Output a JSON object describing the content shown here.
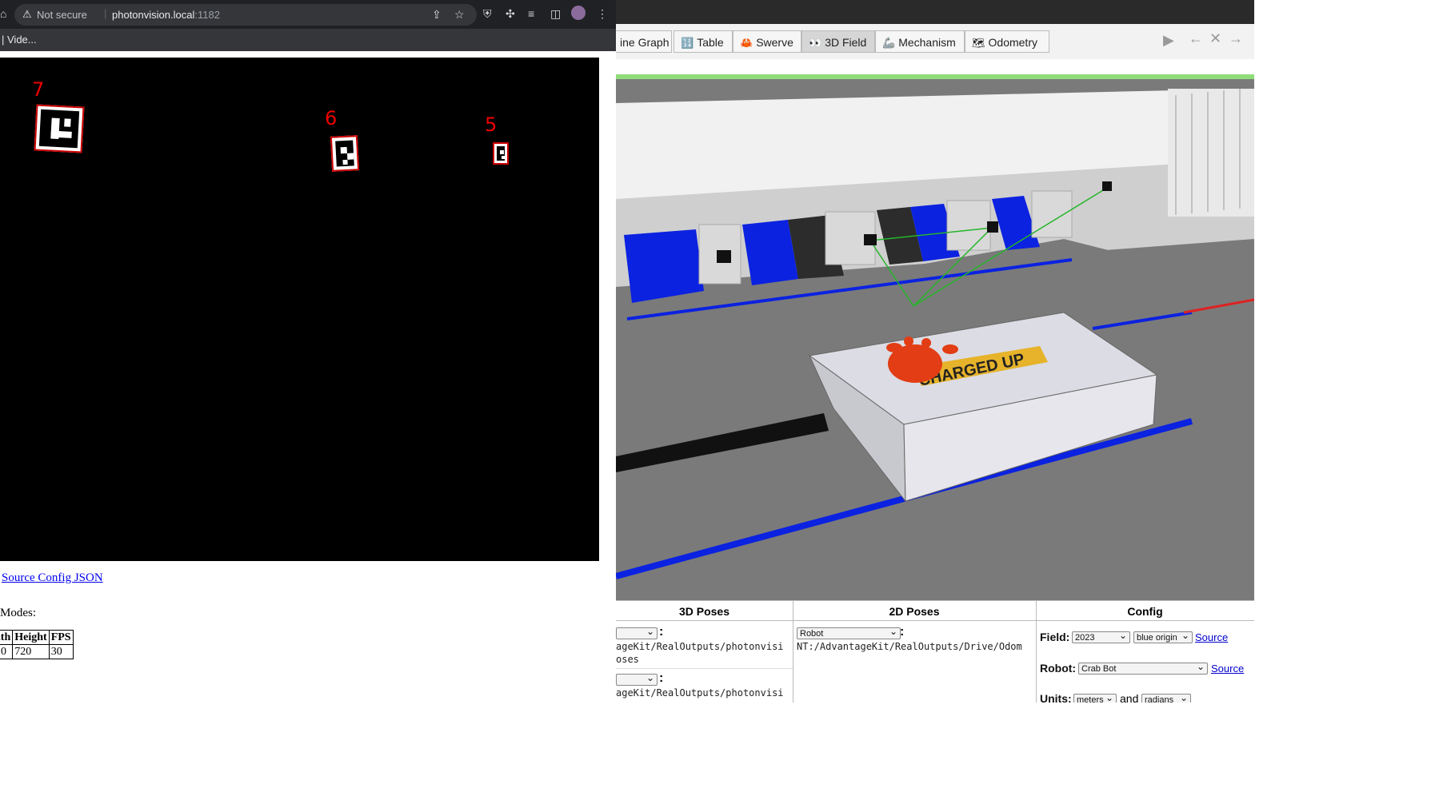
{
  "browser": {
    "not_secure": "Not secure",
    "url_host": "photonvision.local",
    "url_port": ":1182",
    "bookmark": "| Vide...",
    "tags": [
      {
        "id": "7"
      },
      {
        "id": "6"
      },
      {
        "id": "5"
      }
    ],
    "source_link": "Source Config JSON",
    "modes_label": "Modes:",
    "modes_table": {
      "headers": [
        "dth",
        "Height",
        "FPS"
      ],
      "row": [
        "0",
        "720",
        "30"
      ]
    }
  },
  "scope": {
    "tabs": [
      {
        "label": "ine Graph",
        "icon": ""
      },
      {
        "label": "Table",
        "icon": "🔢"
      },
      {
        "label": "Swerve",
        "icon": "🦀"
      },
      {
        "label": "3D Field",
        "icon": "👀"
      },
      {
        "label": "Mechanism",
        "icon": "🦾"
      },
      {
        "label": "Odometry",
        "icon": "🗺"
      }
    ],
    "panels": {
      "poses3d_title": "3D Poses",
      "poses3d_line1": "ageKit/RealOutputs/photonvisi",
      "poses3d_line2": "oses",
      "poses3d_line3": "ageKit/RealOutputs/photonvisi",
      "poses2d_title": "2D Poses",
      "poses2d_select": "Robot",
      "poses2d_path": "NT:/AdvantageKit/RealOutputs/Drive/Odom",
      "config_title": "Config",
      "field_label": "Field:",
      "field_value": "2023",
      "origin_value": "blue origin",
      "source1": "Source",
      "robot_label": "Robot:",
      "robot_value": "Crab Bot",
      "source2": "Source",
      "units_label": "Units:",
      "units_value": "meters",
      "and_label": "and",
      "angle_value": "radians"
    },
    "field_banner": "CHARGED UP"
  }
}
